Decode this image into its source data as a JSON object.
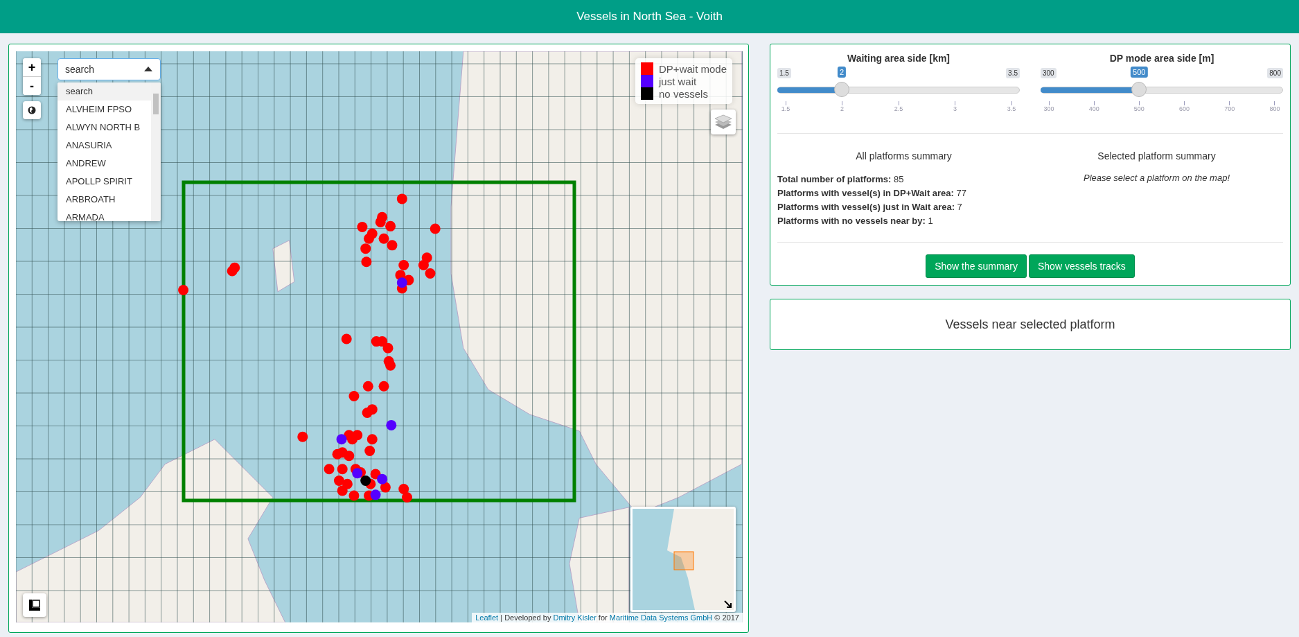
{
  "header": {
    "title": "Vessels in North Sea - Voith"
  },
  "map": {
    "zoom_in": "+",
    "zoom_out": "-",
    "search": {
      "value": "search",
      "options": [
        {
          "label": "search",
          "selected": true
        },
        {
          "label": "ALVHEIM FPSO",
          "selected": false
        },
        {
          "label": "ALWYN NORTH B",
          "selected": false
        },
        {
          "label": "ANASURIA",
          "selected": false
        },
        {
          "label": "ANDREW",
          "selected": false
        },
        {
          "label": "APOLLP SPIRIT",
          "selected": false
        },
        {
          "label": "ARBROATH",
          "selected": false
        },
        {
          "label": "ARMADA",
          "selected": false
        }
      ]
    },
    "legend": [
      {
        "label": "DP+wait mode",
        "color": "#ff0000"
      },
      {
        "label": "just wait",
        "color": "#5500ff"
      },
      {
        "label": "no vessels",
        "color": "#000000"
      }
    ],
    "attribution": [
      {
        "kind": "link",
        "text": "Leaflet"
      },
      {
        "kind": "text",
        "text": " | Developed by "
      },
      {
        "kind": "link",
        "text": "Dmitry Kisler"
      },
      {
        "kind": "text",
        "text": " for "
      },
      {
        "kind": "link",
        "text": "Maritime Data Systems GmbH"
      },
      {
        "kind": "text",
        "text": " © 2017"
      }
    ]
  },
  "sliders": [
    {
      "title": "Waiting area side [km]",
      "min": "1.5",
      "max": "3.5",
      "value": "2",
      "level": 0.25,
      "ticks": [
        "1.5",
        "2",
        "2.5",
        "3",
        "3.5"
      ]
    },
    {
      "title": "DP mode area side [m]",
      "min": "300",
      "max": "800",
      "value": "500",
      "level": 0.4,
      "ticks": [
        "300",
        "400",
        "500",
        "600",
        "700",
        "800"
      ]
    }
  ],
  "all_summary": {
    "title": "All platforms summary",
    "lines": [
      "**Total number of platforms:** 85",
      "**Platforms with vessel(s) in DP+Wait area:** 77",
      "**Platforms with vessel(s) just in Wait area:** 7",
      "**Platforms with no vessels near by:** 1"
    ]
  },
  "selected_summary": {
    "title": "Selected platform summary",
    "message": "Please select a platform on the map!"
  },
  "buttons": [
    "Show the summary",
    "Show vessels tracks"
  ],
  "vessels_panel": {
    "title": "Vessels near selected platform"
  }
}
